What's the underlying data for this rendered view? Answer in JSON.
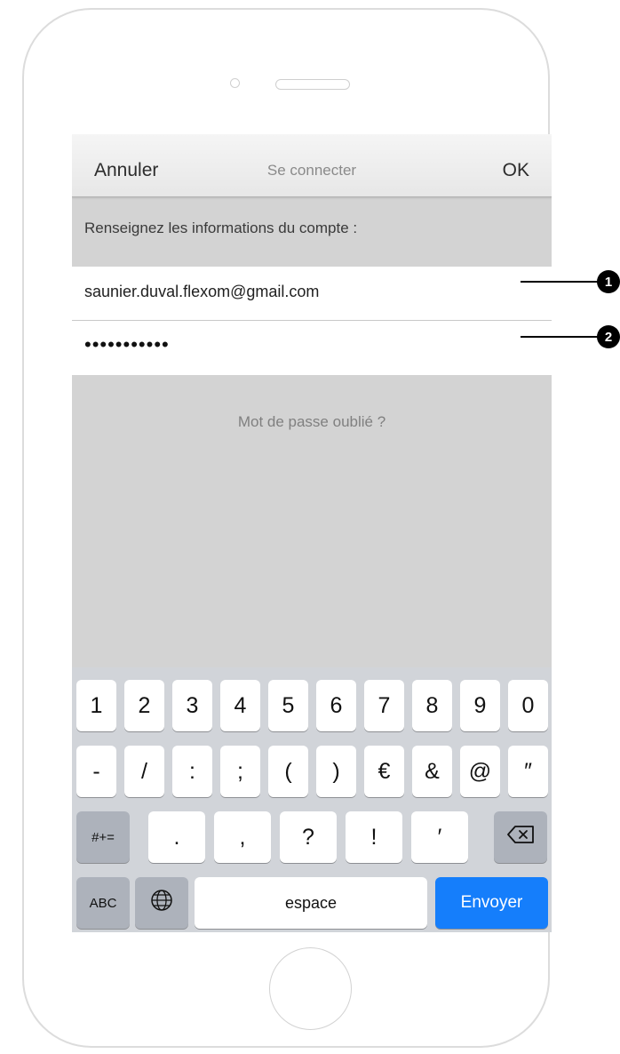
{
  "navbar": {
    "cancel": "Annuler",
    "title": "Se connecter",
    "ok": "OK"
  },
  "form": {
    "section_header": "Renseignez les informations du compte :",
    "email_value": "saunier.duval.flexom@gmail.com",
    "password_mask": "•••••••••••",
    "forgot_password": "Mot de passe oublié ?"
  },
  "keyboard": {
    "row1": [
      "1",
      "2",
      "3",
      "4",
      "5",
      "6",
      "7",
      "8",
      "9",
      "0"
    ],
    "row2": [
      "-",
      "/",
      ":",
      ";",
      "(",
      ")",
      "€",
      "&",
      "@",
      "″"
    ],
    "row3_mode": "#+=",
    "row3": [
      ".",
      ",",
      "?",
      "!",
      "′"
    ],
    "backspace_icon": "backspace-icon",
    "abc": "ABC",
    "globe_icon": "globe-icon",
    "space": "espace",
    "send": "Envoyer"
  },
  "callouts": [
    "1",
    "2"
  ],
  "colors": {
    "send_key": "#157efb",
    "screen_bg": "#d3d3d3",
    "keyboard_bg": "#d1d4d9"
  }
}
